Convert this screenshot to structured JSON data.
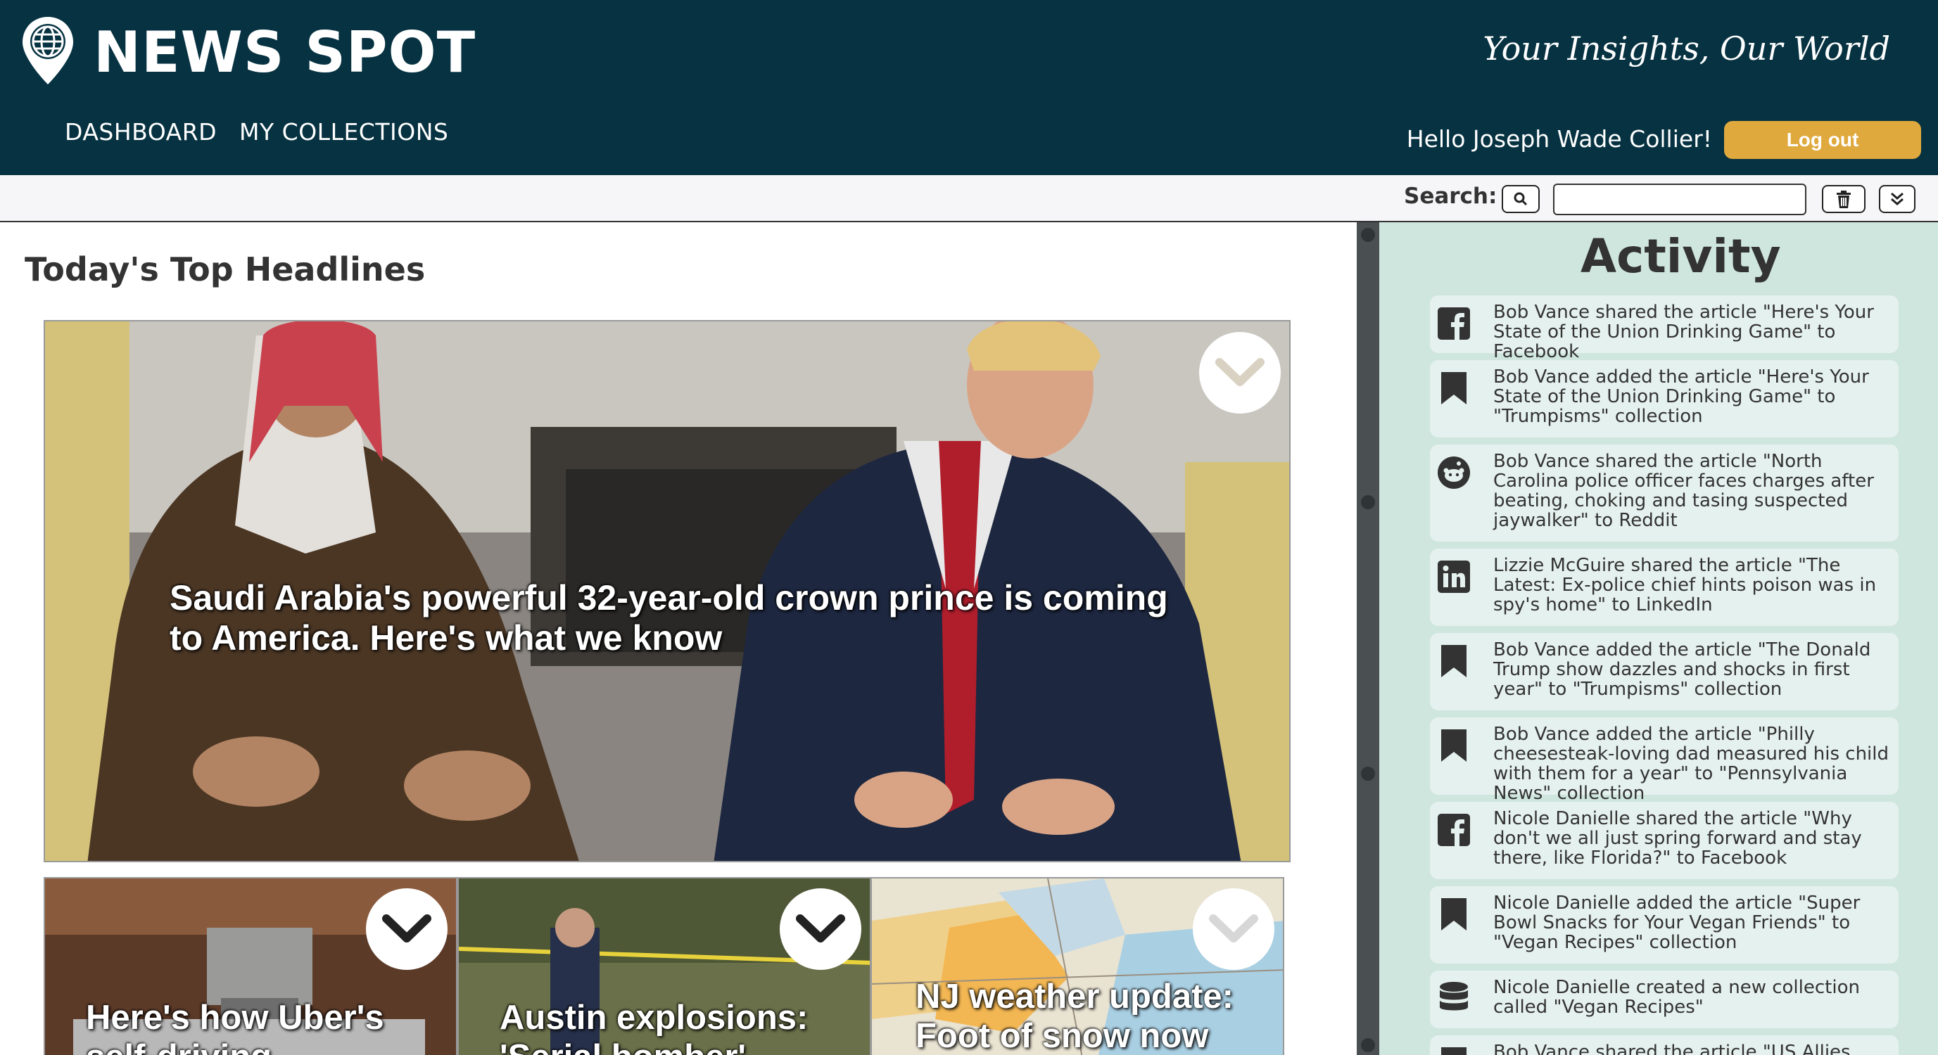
{
  "header": {
    "brand": "NEWS SPOT",
    "tagline": "Your Insights, Our World",
    "nav": [
      "DASHBOARD",
      "MY COLLECTIONS"
    ],
    "greeting": "Hello Joseph Wade Collier!",
    "logout_label": "Log out"
  },
  "search": {
    "label": "Search:",
    "value": ""
  },
  "main": {
    "section_title": "Today's Top Headlines",
    "hero": {
      "title": "Saudi Arabia's powerful 32-year-old crown prince is coming to America. Here's what we know"
    },
    "cards": [
      {
        "title": "Here's how Uber's self-driving"
      },
      {
        "title": "Austin explosions: 'Serial bomber'"
      },
      {
        "title": "NJ weather update: Foot of snow now"
      }
    ]
  },
  "activity": {
    "title": "Activity",
    "items": [
      {
        "icon": "facebook-icon",
        "text": "Bob Vance shared the article \"Here's Your State of the Union Drinking Game\" to Facebook"
      },
      {
        "icon": "bookmark-icon",
        "text": "Bob Vance added the article \"Here's Your State of the Union Drinking Game\" to \"Trumpisms\" collection"
      },
      {
        "icon": "reddit-icon",
        "text": "Bob Vance shared the article \"North Carolina police officer faces charges after beating, choking and tasing suspected jaywalker\" to Reddit"
      },
      {
        "icon": "linkedin-icon",
        "text": "Lizzie McGuire shared the article \"The Latest: Ex-police chief hints poison was in spy's home\" to LinkedIn"
      },
      {
        "icon": "bookmark-icon",
        "text": "Bob Vance added the article \"The Donald Trump show dazzles and shocks in first year\" to \"Trumpisms\" collection"
      },
      {
        "icon": "bookmark-icon",
        "text": "Bob Vance added the article \"Philly cheesesteak-loving dad measured his child with them for a year\" to \"Pennsylvania News\" collection"
      },
      {
        "icon": "facebook-icon",
        "text": "Nicole Danielle shared the article \"Why don't we all just spring forward and stay there, like Florida?\" to Facebook"
      },
      {
        "icon": "bookmark-icon",
        "text": "Nicole Danielle added the article \"Super Bowl Snacks for Your Vegan Friends\" to \"Vegan Recipes\" collection"
      },
      {
        "icon": "database-icon",
        "text": "Nicole Danielle created a new collection called \"Vegan Recipes\""
      },
      {
        "icon": "bookmark-icon",
        "text": "Bob Vance shared the article \"US Allies Sign"
      }
    ]
  }
}
